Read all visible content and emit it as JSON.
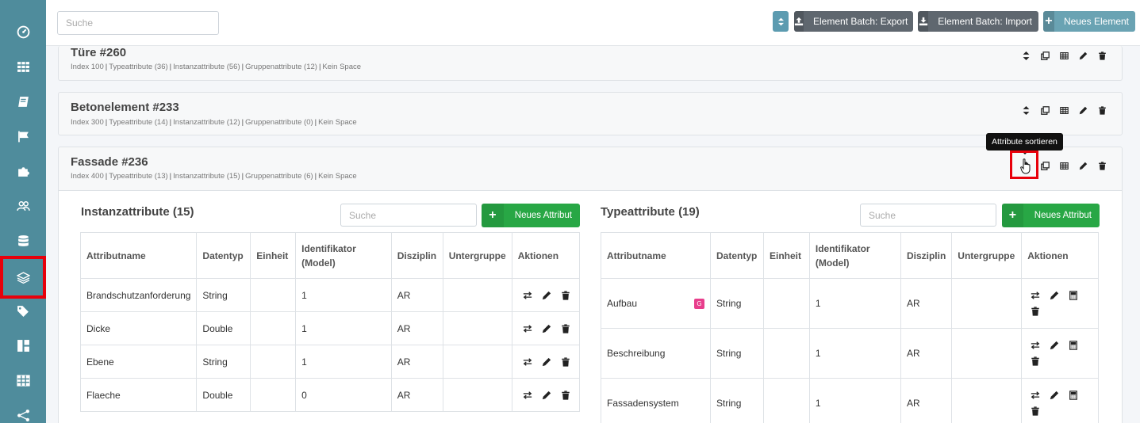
{
  "topbar": {
    "search_placeholder": "Suche",
    "export_label": "Element Batch: Export",
    "import_label": "Element Batch: Import",
    "new_label": "Neues Element"
  },
  "cards": [
    {
      "title": "Türe #260",
      "meta": [
        "Index 100",
        "Typeattribute (36)",
        "Instanzattribute (56)",
        "Gruppenattribute (12)",
        "Kein Space"
      ]
    },
    {
      "title": "Betonelement #233",
      "meta": [
        "Index 300",
        "Typeattribute (14)",
        "Instanzattribute (12)",
        "Gruppenattribute (0)",
        "Kein Space"
      ]
    },
    {
      "title": "Fassade #236",
      "meta": [
        "Index 400",
        "Typeattribute (13)",
        "Instanzattribute (15)",
        "Gruppenattribute (6)",
        "Kein Space"
      ]
    }
  ],
  "tooltip": "Attribute sortieren",
  "instance": {
    "title": "Instanzattribute (15)",
    "search_placeholder": "Suche",
    "new_label": "Neues Attribut",
    "headers": [
      "Attributname",
      "Datentyp",
      "Einheit",
      "Identifikator (Model)",
      "Disziplin",
      "Untergruppe",
      "Aktionen"
    ],
    "rows": [
      [
        "Brandschutzanforderung",
        "String",
        "",
        "1",
        "AR",
        ""
      ],
      [
        "Dicke",
        "Double",
        "",
        "1",
        "AR",
        ""
      ],
      [
        "Ebene",
        "String",
        "",
        "1",
        "AR",
        ""
      ],
      [
        "Flaeche",
        "Double",
        "",
        "0",
        "AR",
        ""
      ]
    ]
  },
  "type": {
    "title": "Typeattribute (19)",
    "search_placeholder": "Suche",
    "new_label": "Neues Attribut",
    "headers": [
      "Attributname",
      "Datentyp",
      "Einheit",
      "Identifikator (Model)",
      "Disziplin",
      "Untergruppe",
      "Aktionen"
    ],
    "badge": "G",
    "rows": [
      [
        "Aufbau",
        "String",
        "",
        "1",
        "AR",
        ""
      ],
      [
        "Beschreibung",
        "String",
        "",
        "1",
        "AR",
        ""
      ],
      [
        "Fassadensystem",
        "String",
        "",
        "1",
        "AR",
        ""
      ]
    ]
  },
  "colors": {
    "sidebar": "#4f8c9c",
    "green": "#28a745",
    "highlight": "#e8000b",
    "dark_button": "#5f676f"
  }
}
